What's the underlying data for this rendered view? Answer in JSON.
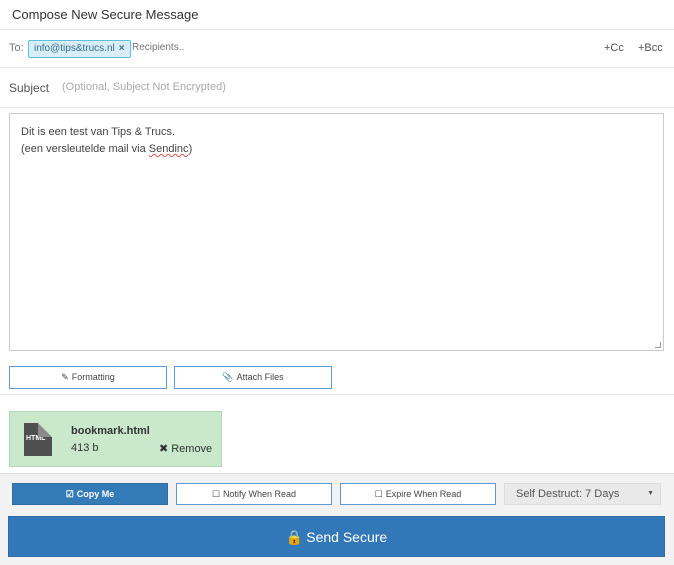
{
  "title": "Compose New Secure Message",
  "to": {
    "label": "To:",
    "recipient": "info@tips&trucs.nl",
    "remove_glyph": "×",
    "placeholder": "Recipients..",
    "cc": "+Cc",
    "bcc": "+Bcc"
  },
  "subject": {
    "label": "Subject",
    "placeholder": "(Optional, Subject Not Encrypted)"
  },
  "body": {
    "line1": "Dit is een test van Tips & Trucs.",
    "line2_prefix": "(een versleutelde mail via ",
    "line2_word": "Sendinc",
    "line2_suffix": ")"
  },
  "toolbar": {
    "formatting": "Formatting",
    "attach": "Attach Files"
  },
  "attachment": {
    "icon_text": "HTML",
    "name": "bookmark.html",
    "size": "413 b",
    "remove": "Remove"
  },
  "options": {
    "copy_me": "Copy Me",
    "notify": "Notify When Read",
    "expire": "Expire When Read",
    "self_destruct": "Self Destruct: 7 Days"
  },
  "send": "Send Secure",
  "colors": {
    "primary": "#337ab7",
    "attachment_bg": "#c9e8cc",
    "chip_bg": "#d9edf7"
  }
}
